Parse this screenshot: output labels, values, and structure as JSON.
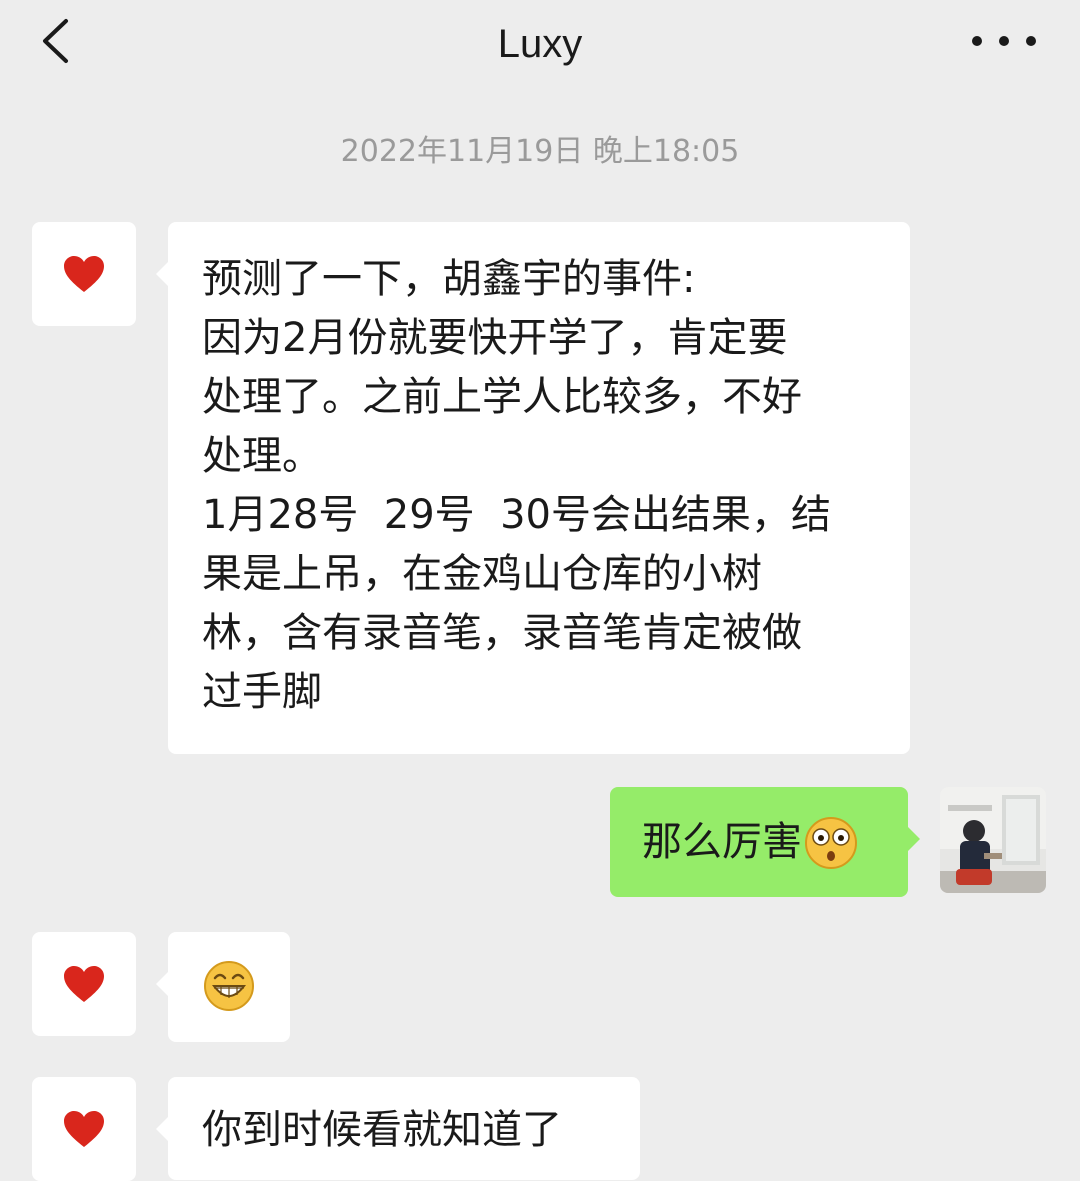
{
  "header": {
    "title": "Luxy",
    "back_icon": "chevron-left-icon",
    "more_icon": "more-dots-icon"
  },
  "timestamp": "2022年11月19日 晚上18:05",
  "contact_avatar_icon": "heart-icon",
  "colors": {
    "background": "#ededed",
    "incoming_bubble": "#ffffff",
    "outgoing_bubble": "#95ec69",
    "heart": "#d9261c",
    "timestamp_text": "#9a9a9a"
  },
  "messages": [
    {
      "direction": "incoming",
      "text": "预测了一下，胡鑫宇的事件:\n因为2月份就要快开学了，肯定要\n处理了。之前上学人比较多，不好\n处理。\n1月28号  29号  30号会出结果，结\n果是上吊，在金鸡山仓库的小树\n林，含有录音笔，录音笔肯定被做\n过手脚"
    },
    {
      "direction": "outgoing",
      "text": "那么厉害",
      "emoji": "surprised-emoji-icon"
    },
    {
      "direction": "incoming",
      "emoji": "grin-emoji-icon"
    },
    {
      "direction": "incoming",
      "text": "你到时候看就知道了"
    }
  ]
}
